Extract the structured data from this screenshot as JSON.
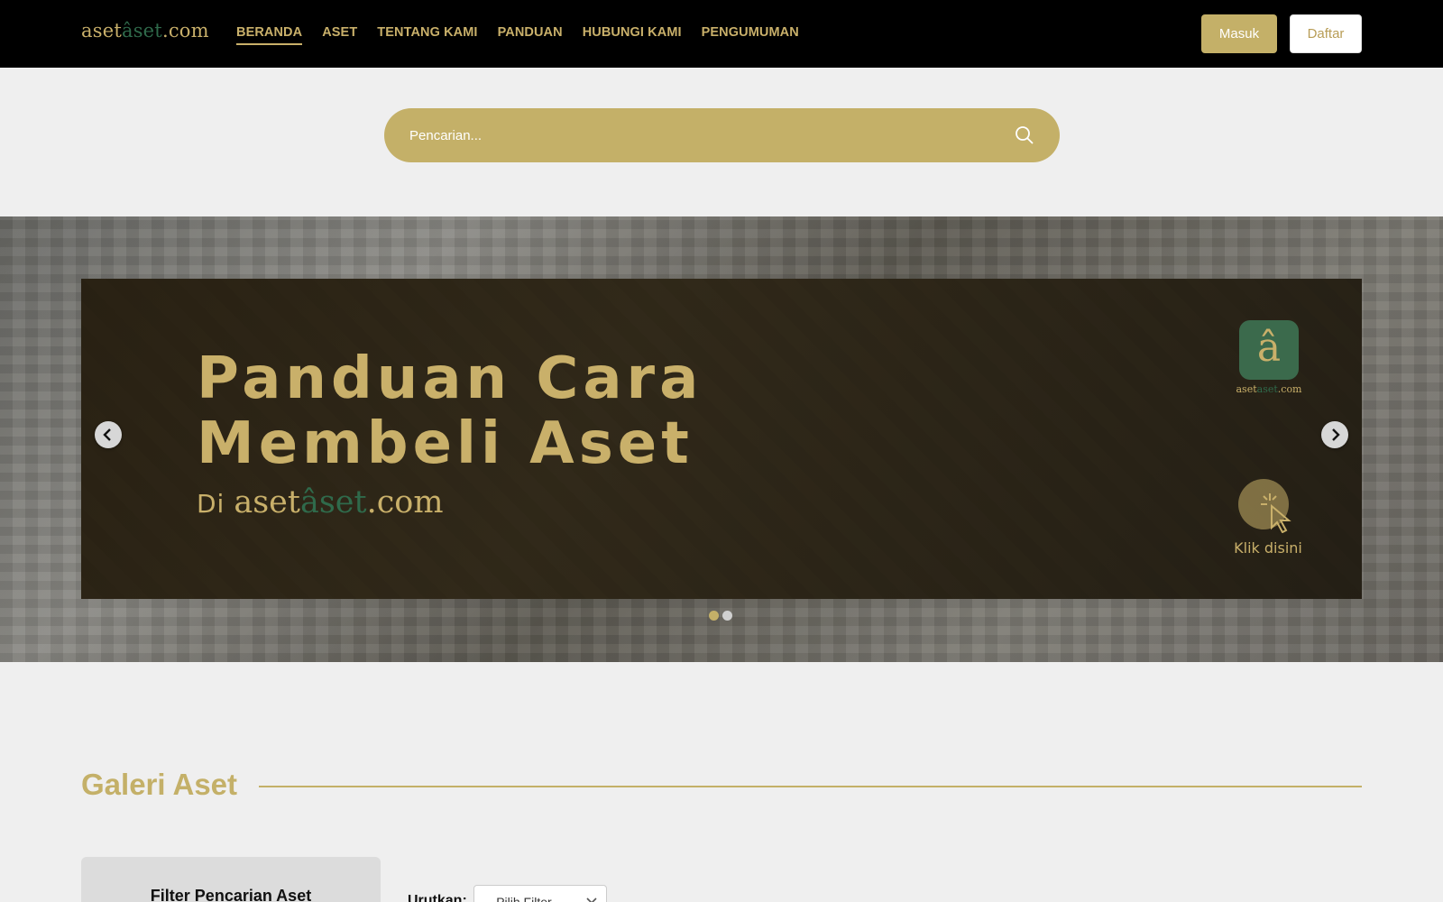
{
  "header": {
    "logo_prefix": "aset",
    "logo_mid": "âset",
    "logo_suffix": ".com",
    "nav": [
      "BERANDA",
      "ASET",
      "TENTANG KAMI",
      "PANDUAN",
      "HUBUNGI KAMI",
      "PENGUMUMAN"
    ],
    "active_nav": "BERANDA",
    "login_label": "Masuk",
    "register_label": "Daftar"
  },
  "search": {
    "placeholder": "Pencarian...",
    "icon": "search-icon"
  },
  "carousel": {
    "slide_title_line1": "Panduan Cara",
    "slide_title_line2": "Membeli Aset",
    "slide_sub_prefix": "Di",
    "brand_prefix": "aset",
    "brand_mid": "âset",
    "brand_suffix": ".com",
    "badge_glyph": "â",
    "badge_prefix": "aset",
    "badge_mid": "aset",
    "badge_suffix": ".com",
    "cta_label": "Klik disini",
    "slide_count": 2,
    "active_slide": 1
  },
  "gallery": {
    "title": "Galeri Aset",
    "filter_title": "Filter Pencarian Aset",
    "sort_label": "Urutkan:",
    "sort_selected": "-- Pilih Filter --"
  },
  "colors": {
    "accent": "#c4b068",
    "brand_green": "#2f6a4b",
    "nav_bg": "#000000",
    "page_bg": "#efefef"
  }
}
